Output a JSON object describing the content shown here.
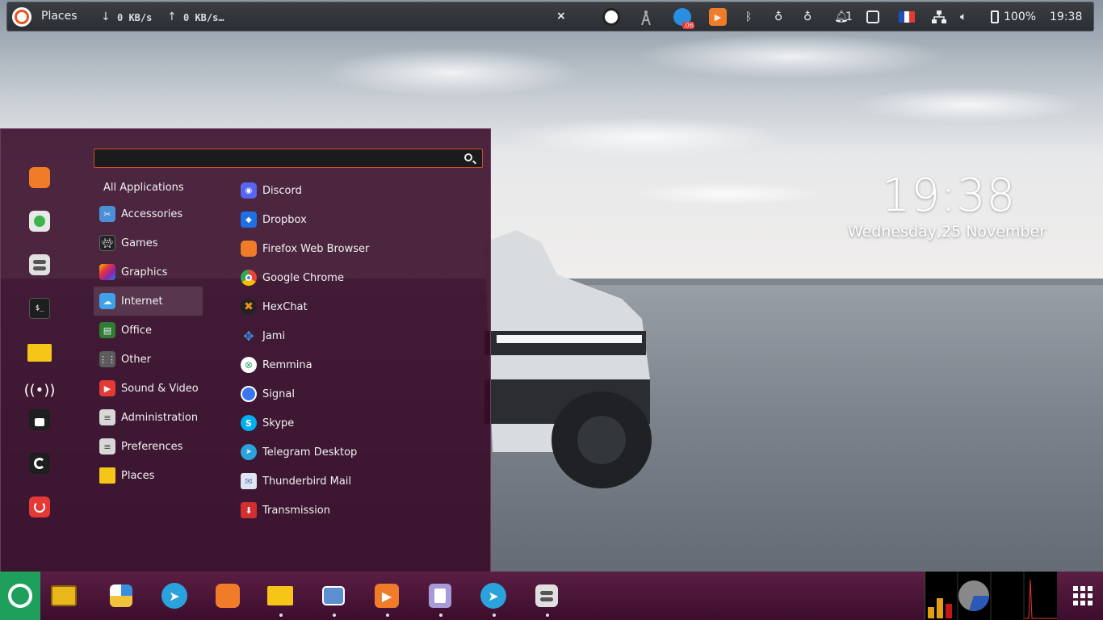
{
  "top_panel": {
    "places_label": "Places",
    "download_arrow": "↓",
    "download_speed": "0 KB/s",
    "upload_arrow": "↑",
    "upload_speed": "0 KB/s…",
    "close_glyph": "×",
    "tray_badge": ".06",
    "notifications_count": "1",
    "battery": "100%",
    "clock": "19:38"
  },
  "desktop_clock": {
    "time": "19:38",
    "date": "Wednesday,25 November"
  },
  "menu": {
    "search": {
      "value": "",
      "placeholder": ""
    },
    "favorites": [
      {
        "name": "firefox-icon",
        "color": "#f07c2a"
      },
      {
        "name": "app-grid-icon",
        "color": "#e8e8e8"
      },
      {
        "name": "settings-toggle-icon",
        "color": "#e0e0e0"
      },
      {
        "name": "terminal-icon",
        "color": "#1e1e1e"
      },
      {
        "name": "folder-icon",
        "color": "#f5c518"
      },
      {
        "name": "broadcast-icon",
        "color": "transparent"
      },
      {
        "name": "lock-icon",
        "color": "#1e1e1e"
      },
      {
        "name": "logout-icon",
        "color": "#1e1e1e"
      },
      {
        "name": "power-icon",
        "color": "#e53935"
      }
    ],
    "all_applications_label": "All Applications",
    "categories": [
      {
        "label": "Accessories",
        "icon": "accessories-icon",
        "color": "#4a90d9"
      },
      {
        "label": "Games",
        "icon": "games-icon",
        "color": "#222222"
      },
      {
        "label": "Graphics",
        "icon": "graphics-icon",
        "color": "#c04fd8"
      },
      {
        "label": "Internet",
        "icon": "internet-icon",
        "color": "#3fa2e8"
      },
      {
        "label": "Office",
        "icon": "office-icon",
        "color": "#2e7d32"
      },
      {
        "label": "Other",
        "icon": "other-icon",
        "color": "#5c5c5c"
      },
      {
        "label": "Sound & Video",
        "icon": "sound-video-icon",
        "color": "#e53935"
      },
      {
        "label": "Administration",
        "icon": "administration-icon",
        "color": "#d8d8d8"
      },
      {
        "label": "Preferences",
        "icon": "preferences-icon",
        "color": "#d8d8d8"
      },
      {
        "label": "Places",
        "icon": "places-folder-icon",
        "color": "#f5c518"
      }
    ],
    "active_category": "Internet",
    "applications": [
      {
        "label": "Discord",
        "icon": "discord-icon",
        "color": "#5865f2"
      },
      {
        "label": "Dropbox",
        "icon": "dropbox-icon",
        "color": "#1f6fe5"
      },
      {
        "label": "Firefox Web Browser",
        "icon": "firefox-icon",
        "color": "#f07c2a"
      },
      {
        "label": "Google Chrome",
        "icon": "chrome-icon",
        "color": "#34a853"
      },
      {
        "label": "HexChat",
        "icon": "hexchat-icon",
        "color": "#f09020"
      },
      {
        "label": "Jami",
        "icon": "jami-icon",
        "color": "#1f7ad1"
      },
      {
        "label": "Remmina",
        "icon": "remmina-icon",
        "color": "#3aa675"
      },
      {
        "label": "Signal",
        "icon": "signal-icon",
        "color": "#3a76f0"
      },
      {
        "label": "Skype",
        "icon": "skype-icon",
        "color": "#00aff0"
      },
      {
        "label": "Telegram Desktop",
        "icon": "telegram-icon",
        "color": "#2aa3dc"
      },
      {
        "label": "Thunderbird Mail",
        "icon": "thunderbird-icon",
        "color": "#8aa8d8"
      },
      {
        "label": "Transmission",
        "icon": "transmission-icon",
        "color": "#d32f2f"
      }
    ]
  },
  "dock": {
    "items": [
      {
        "name": "files-icon",
        "color": "#e9b61c"
      },
      {
        "name": "collage-icon",
        "color": "#f2c23a"
      },
      {
        "name": "telegram-icon",
        "color": "#2aa3dc"
      },
      {
        "name": "firefox-icon",
        "color": "#f07c2a"
      },
      {
        "name": "folder-icon",
        "color": "#f5c518"
      },
      {
        "name": "camera-icon",
        "color": "#5b8fd1"
      },
      {
        "name": "media-player-icon",
        "color": "#f07c2a"
      },
      {
        "name": "text-editor-icon",
        "color": "#a79ad8"
      },
      {
        "name": "telegram-icon",
        "color": "#2aa3dc"
      },
      {
        "name": "settings-toggle-icon",
        "color": "#e0e0e0"
      }
    ],
    "system_monitor": {
      "cpu_bars": [
        {
          "fraction": 0.4,
          "color": "#e0a010"
        },
        {
          "fraction": 0.7,
          "color": "#e0a010"
        },
        {
          "fraction": 0.5,
          "color": "#c01818"
        }
      ],
      "pie_fraction": 0.3,
      "pie_colors": [
        "#2a59b8",
        "#888888"
      ]
    }
  }
}
